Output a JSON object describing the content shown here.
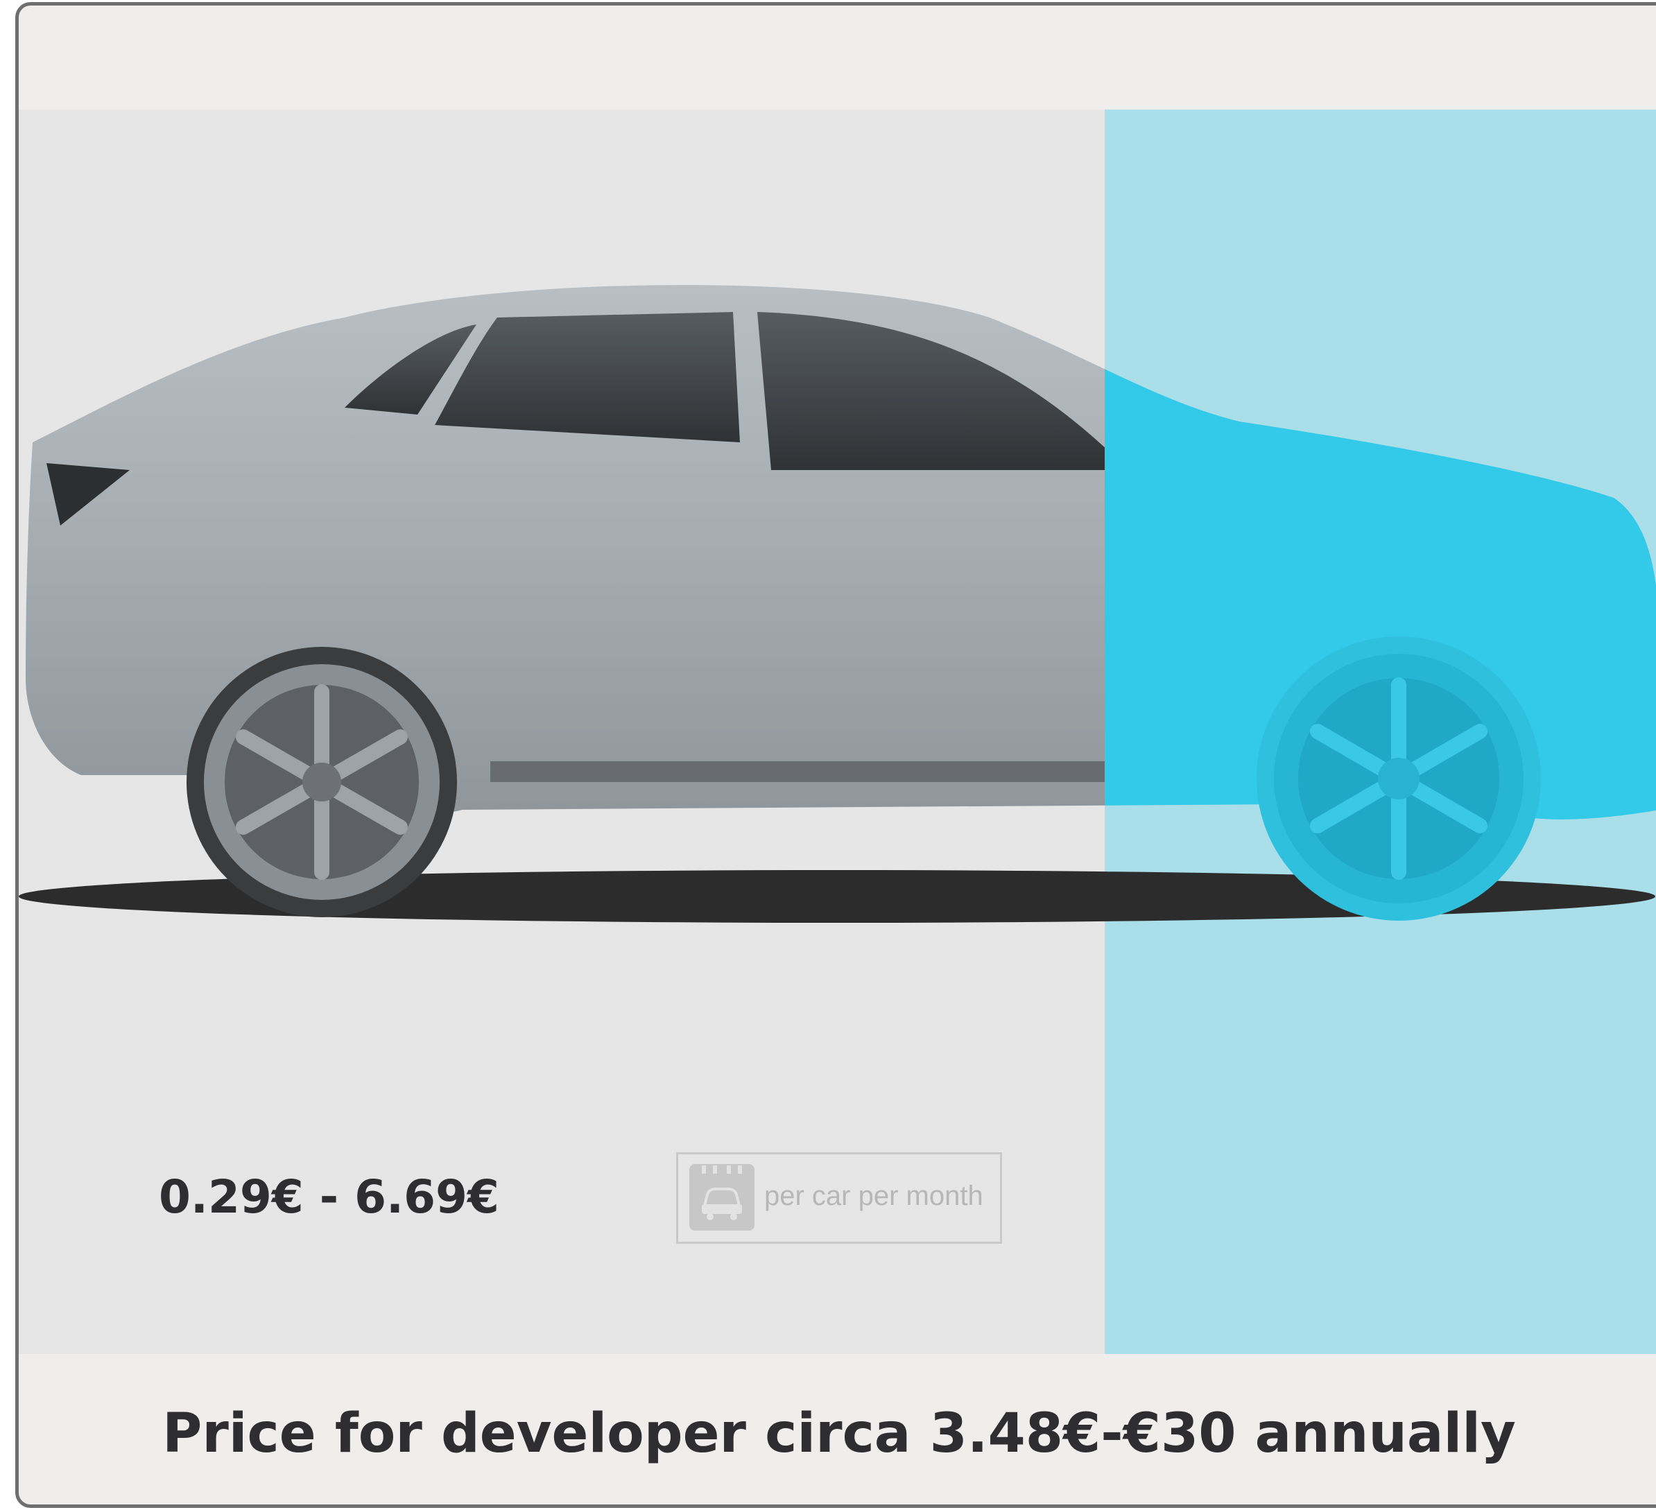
{
  "banner": {
    "price_range": "0.29€ - 6.69€",
    "unit_badge": {
      "icon": "car-calendar-icon",
      "text": "per car per month"
    },
    "highlight_color": "#aadfe9",
    "highlight_car_color": "#33c9e8",
    "car_body_color": "#a5acb1"
  },
  "caption": {
    "text": "Price for developer circa 3.48€-€30 annually"
  }
}
